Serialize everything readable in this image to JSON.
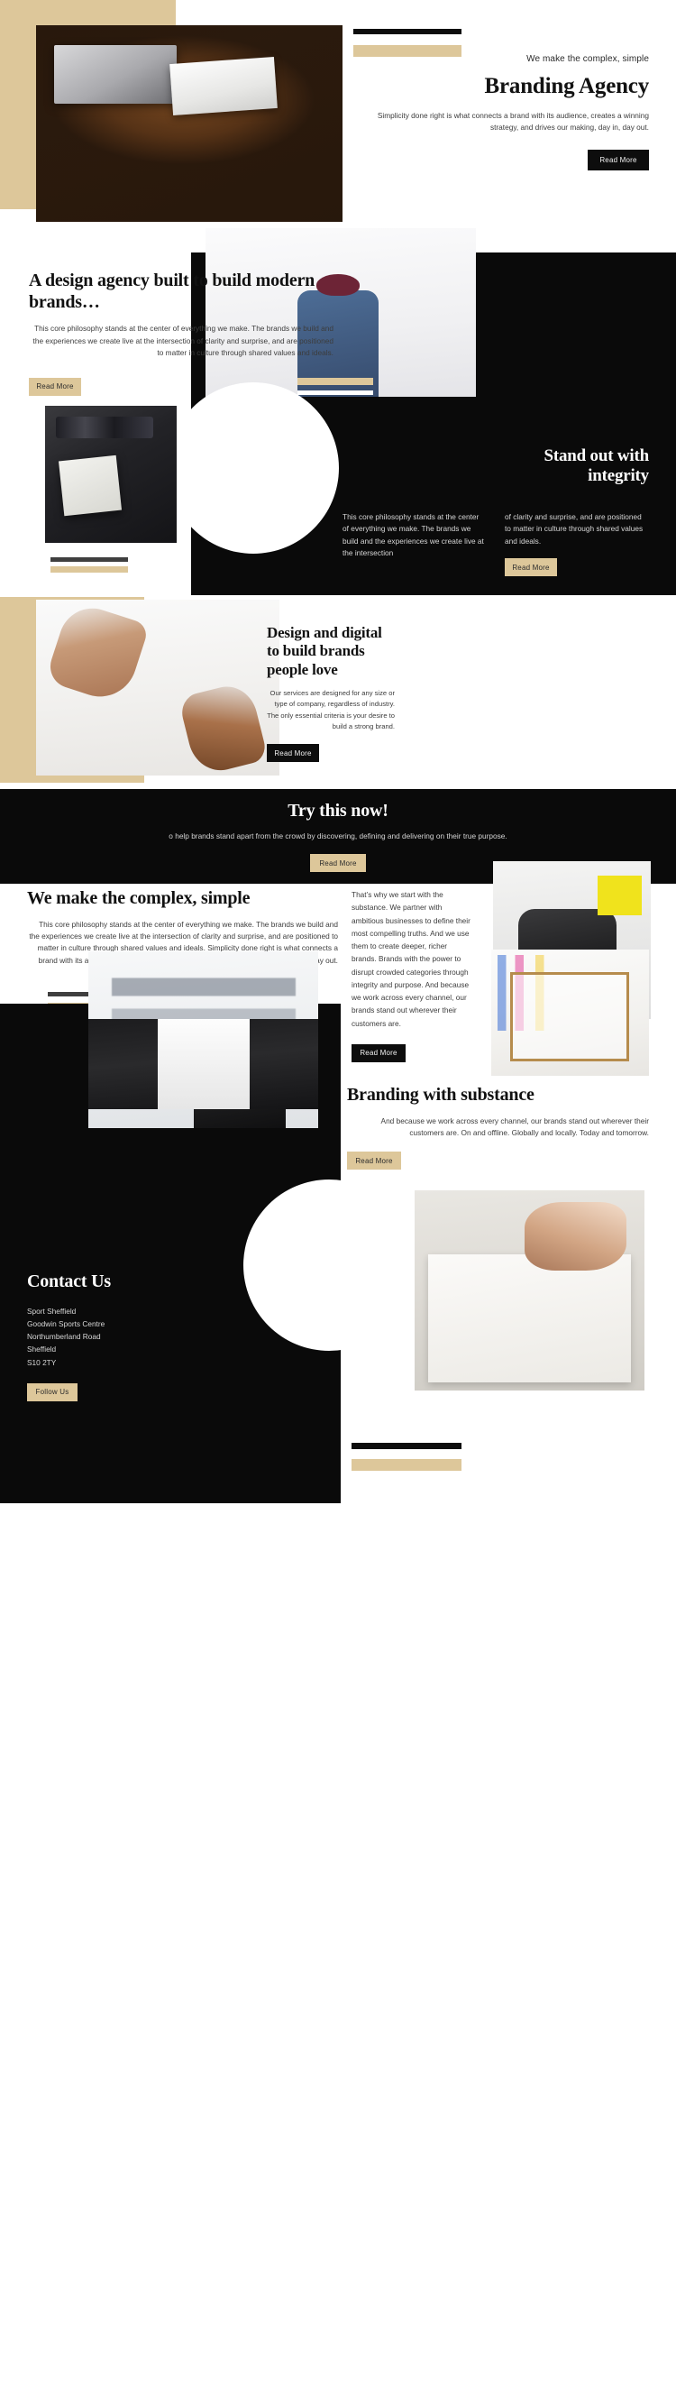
{
  "theme": {
    "accent_tan": "#ddc79a",
    "dark": "#0a0a0a",
    "gray_bar": "#3f3f3f",
    "text": "#1a1a1a",
    "body_text": "#3c3c3c"
  },
  "hero": {
    "eyebrow": "We make the complex, simple",
    "title": "Branding Agency",
    "paragraph": "Simplicity done right is what connects a brand with its audience, creates a winning strategy, and drives our making, day in, day out.",
    "cta": "Read More",
    "image_alt": "desk-with-laptop-coffee-and-magazines-photo"
  },
  "design_agency": {
    "title": "A design agency built to build modern brands…",
    "paragraph": "This core philosophy stands at the center of everything we make. The brands we build and the experiences we create live at the intersection of clarity and surprise, and are positioned to matter in culture through shared values and ideals.",
    "cta": "Read More",
    "image_alt": "man-drawing-flowchart-on-whiteboard-photo",
    "image_alt_2": "desk-with-wireframe-sketches-and-pens-photo"
  },
  "integrity": {
    "title_line1": "Stand out with",
    "title_line2": "integrity",
    "column_left": "This core philosophy stands at the center of everything we make. The brands we build and the experiences we create live at the intersection",
    "column_right": "of clarity and surprise, and are positioned to matter in culture through shared values and ideals.",
    "cta": "Read More"
  },
  "design_digital": {
    "title": "Design and digital to build brands people love",
    "paragraph": "Our services are designed for any size or type of company, regardless of industry. The only essential criteria is your desire to build a strong brand.",
    "cta": "Read More",
    "image_alt": "four-pairs-of-hands-reaching-inward-photo"
  },
  "try_now": {
    "title": "Try this now!",
    "paragraph": "o help brands stand apart from the crowd by discovering, defining and delivering on their true purpose.",
    "cta": "Read More"
  },
  "complex_simple": {
    "title": "We make the complex, simple",
    "paragraph": "This core philosophy stands at the center of everything we make. The brands we build and the experiences we create live at the intersection of clarity and surprise, and are positioned to matter in culture through shared values and ideals. Simplicity done right is what connects a brand with its audience, creates a winning strategy, and drives our making, day in, day out.",
    "side_paragraph": "That’s why we start with the substance. We partner with ambitious businesses to define their most compelling truths. And we use them to create deeper, richer brands. Brands with the power to disrupt crowded categories through integrity and purpose. And because we work across every channel, our brands stand out wherever their customers are.",
    "cta": "Read More",
    "image_alt": "man-with-backpack-and-cap-facing-wall-photo",
    "image_alt_2": "blurred-enjoy-it-poster-with-person-writing-photo"
  },
  "branding_substance": {
    "title": "Branding with substance",
    "paragraph": "And because we work across every channel, our brands stand out wherever their customers are. On and offline. Globally and locally. Today and tomorrow.",
    "cta": "Read More",
    "image_alt": "hands-sketching-diagrams-on-pinboard-photo"
  },
  "contact": {
    "title": "Contact Us",
    "address_lines": [
      "Sport Sheffield",
      "Goodwin Sports Centre",
      "Northumberland Road",
      "Sheffield",
      "S10 2TY"
    ],
    "cta": "Follow Us",
    "image_alt": "hand-sketching-fashion-figures-with-pencil-photo"
  }
}
